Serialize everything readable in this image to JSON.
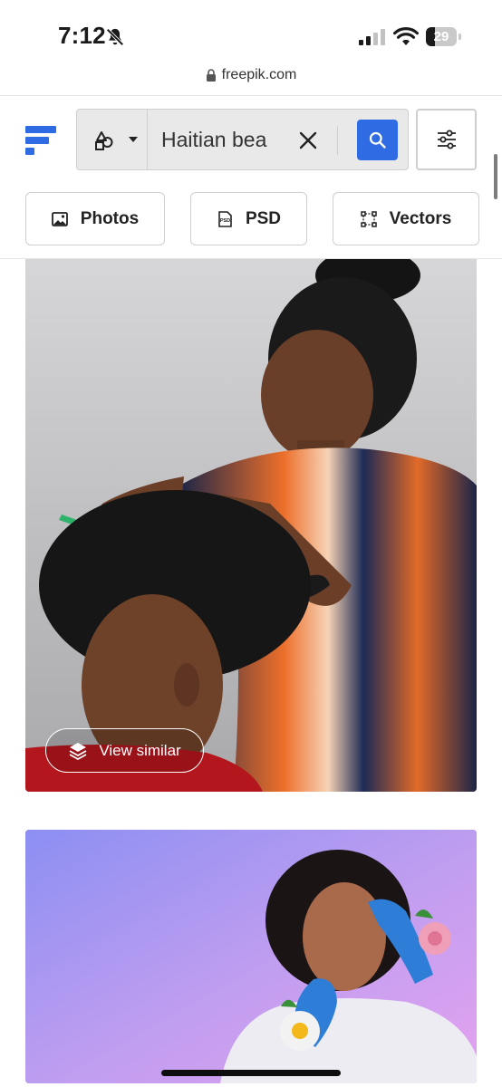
{
  "status_bar": {
    "time": "7:12",
    "battery_level": "29",
    "battery_fraction": 0.29,
    "icons": [
      "bell-muted-icon",
      "cellular-signal-icon",
      "wifi-icon",
      "battery-icon"
    ]
  },
  "browser": {
    "url": "freepik.com",
    "lock_icon": "lock-icon"
  },
  "header": {
    "logo_icon": "freepik-logo-icon",
    "search": {
      "type_icon": "shapes-icon",
      "query": "Haitian bea",
      "clear_icon": "close-icon",
      "search_icon": "magnifier-icon"
    },
    "filter_icon": "sliders-icon",
    "accent_color": "#2f6be3"
  },
  "categories": [
    {
      "label": "Photos",
      "icon": "image-icon"
    },
    {
      "label": "PSD",
      "icon": "psd-file-icon"
    },
    {
      "label": "Vectors",
      "icon": "vector-nodes-icon"
    }
  ],
  "results": [
    {
      "view_similar_label": "View similar",
      "view_similar_icon": "layers-icon"
    },
    {}
  ]
}
